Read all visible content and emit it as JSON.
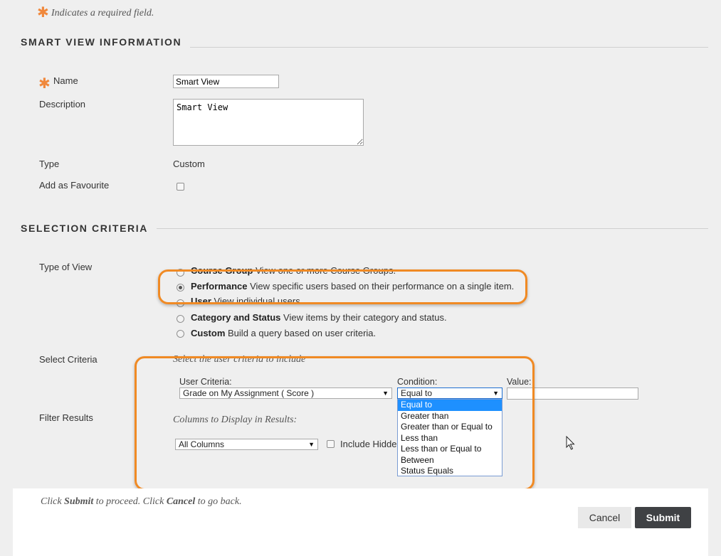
{
  "required_note": "Indicates a required field.",
  "smart_view_section": {
    "title": "SMART VIEW INFORMATION",
    "name_label": "Name",
    "name_value": "Smart View",
    "description_label": "Description",
    "description_value": "Smart View",
    "type_label": "Type",
    "type_value": "Custom",
    "favourite_label": "Add as Favourite"
  },
  "selection_section": {
    "title": "SELECTION CRITERIA",
    "type_of_view_label": "Type of View",
    "view_options": [
      {
        "name": "Course Group",
        "desc": "View one or more Course Groups."
      },
      {
        "name": "Performance",
        "desc": "View specific users based on their performance on a single item."
      },
      {
        "name": "User",
        "desc": "View individual users."
      },
      {
        "name": "Category and Status",
        "desc": "View items by their category and status."
      },
      {
        "name": "Custom",
        "desc": "Build a query based on user criteria."
      }
    ],
    "select_criteria_label": "Select Criteria",
    "select_criteria_hint": "Select the user criteria to include",
    "user_criteria_label": "User Criteria:",
    "user_criteria_value": "Grade on My Assignment ( Score )",
    "condition_label": "Condition:",
    "condition_value": "Equal to",
    "value_label": "Value:",
    "value_value": "",
    "condition_options": [
      "Equal to",
      "Greater than",
      "Greater than or Equal to",
      "Less than",
      "Less than or Equal to",
      "Between",
      "Status Equals"
    ],
    "filter_results_label": "Filter Results",
    "columns_hint": "Columns to Display in Results:",
    "columns_value": "All Columns",
    "include_hidden_label": "Include Hidden"
  },
  "footer": {
    "instr_1": "Click ",
    "instr_submit": "Submit",
    "instr_2": " to proceed. Click ",
    "instr_cancel": "Cancel",
    "instr_3": " to go back.",
    "cancel_label": "Cancel",
    "submit_label": "Submit"
  },
  "colors": {
    "accent_orange": "#f08a24",
    "submit_bg": "#3f4144",
    "cancel_bg": "#e9e9e9",
    "dropdown_highlight": "#1e90ff"
  }
}
